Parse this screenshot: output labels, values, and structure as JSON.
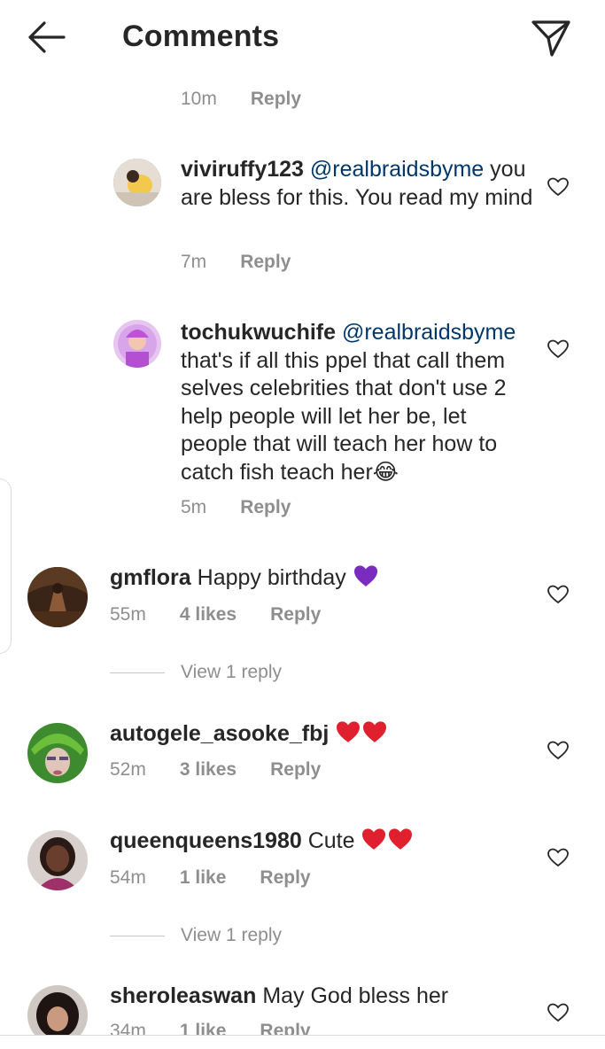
{
  "header": {
    "title": "Comments",
    "back_icon": "arrow-left-icon",
    "send_icon": "paper-plane-icon"
  },
  "top_meta": {
    "time": "10m",
    "reply": "Reply"
  },
  "replies": [
    {
      "username": "viviruffy123",
      "mention": "@realbraidsbyme",
      "text": "you are bless for this. You read my mind",
      "time": "7m",
      "reply": "Reply"
    },
    {
      "username": "tochukwuchife",
      "mention": "@realbraidsbyme",
      "text": "that's if all this ppel that call them selves celebrities that don't use 2 help people will let her be, let people that will teach her how to catch fish teach her",
      "emoji": "😂",
      "time": "5m",
      "reply": "Reply"
    }
  ],
  "comments": [
    {
      "username": "gmflora",
      "text": "Happy birthday",
      "emoji": "💜",
      "time": "55m",
      "likes": "4 likes",
      "reply": "Reply",
      "view_replies": "View 1 reply"
    },
    {
      "username": "autogele_asooke_fbj",
      "text": "",
      "emoji": "❤❤",
      "time": "52m",
      "likes": "3 likes",
      "reply": "Reply"
    },
    {
      "username": "queenqueens1980",
      "text": "Cute",
      "emoji": "❤❤",
      "time": "54m",
      "likes": "1 like",
      "reply": "Reply",
      "view_replies": "View 1 reply"
    },
    {
      "username": "sheroleaswan",
      "text": "May God bless her",
      "time": "34m",
      "likes": "1 like",
      "reply": "Reply"
    }
  ],
  "colors": {
    "text": "#262626",
    "meta": "#8e8e8e",
    "mention": "#00376b",
    "heart_emoji": "#e0202e",
    "purple_heart": "#7b2cbf"
  }
}
